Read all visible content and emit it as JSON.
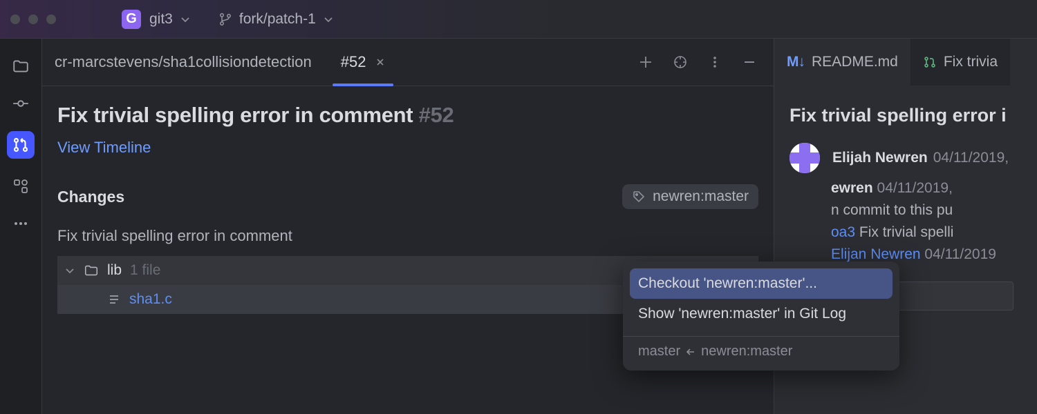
{
  "titlebar": {
    "repo_badge": "G",
    "repo_name": "git3",
    "branch": "fork/patch-1"
  },
  "tabs": {
    "breadcrumb": "cr-marcstevens/sha1collisiondetection",
    "active": "#52"
  },
  "pr": {
    "title": "Fix trivial spelling error in comment",
    "number": "#52",
    "view_timeline": "View Timeline",
    "changes_heading": "Changes",
    "branch_tag": "newren:master",
    "description": "Fix trivial spelling error in comment",
    "tree": {
      "folder": "lib",
      "file_count": "1 file",
      "file": "sha1.c"
    }
  },
  "menu": {
    "checkout": "Checkout 'newren:master'...",
    "show_log": "Show 'newren:master' in Git Log",
    "merge_target": "master",
    "merge_source": "newren:master"
  },
  "right": {
    "tab1": "README.md",
    "tab2": "Fix trivia",
    "title": "Fix trivial spelling error i",
    "author": "Elijah Newren",
    "date1": "04/11/2019,",
    "line2_who": "ewren",
    "line2_date": "04/11/2019,",
    "line3": "n commit to this pu",
    "commit_hash": "oa3",
    "commit_msg": "Fix trivial spelli",
    "commit_who": "Elijan Newren",
    "commit_date": "04/11/2019"
  },
  "icons": {
    "chevron_down": "chevron-down",
    "branch": "branch",
    "folder": "folder",
    "commit": "commit",
    "pr": "pull-request",
    "apps": "apps",
    "more": "more",
    "plus": "plus",
    "target": "target",
    "vdots": "kebab",
    "minimize": "minimize",
    "tag": "tag",
    "file": "file"
  }
}
